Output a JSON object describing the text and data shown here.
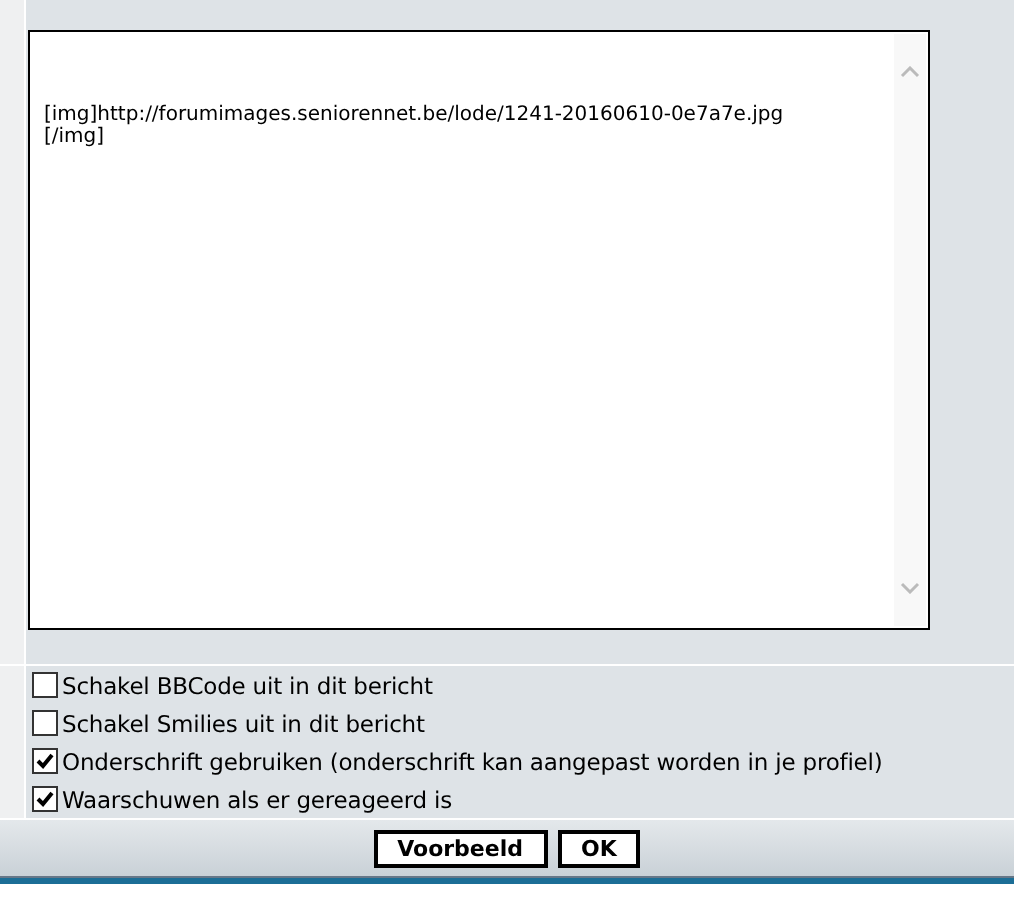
{
  "message": {
    "value": "[img]http://forumimages.seniorennet.be/lode/1241-20160610-0e7a7e.jpg[/img]"
  },
  "options": [
    {
      "label": "Schakel BBCode uit in dit bericht",
      "checked": false
    },
    {
      "label": "Schakel Smilies uit in dit bericht",
      "checked": false
    },
    {
      "label": "Onderschrift gebruiken (onderschrift kan aangepast worden in je profiel)",
      "checked": true
    },
    {
      "label": "Waarschuwen als er gereageerd is",
      "checked": true
    }
  ],
  "buttons": [
    {
      "label": "Voorbeeld"
    },
    {
      "label": "OK"
    }
  ]
}
